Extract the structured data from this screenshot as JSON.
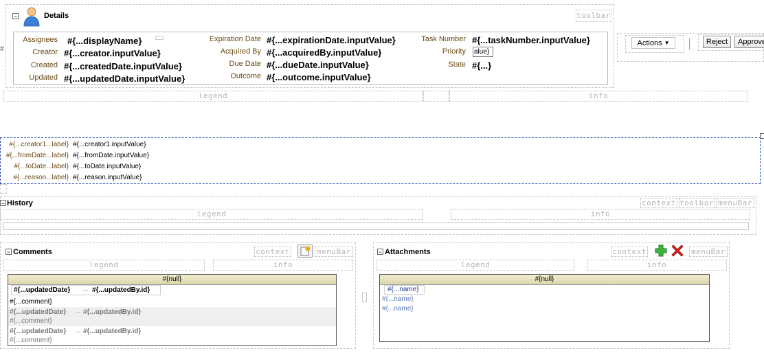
{
  "details": {
    "title": "Details",
    "toolbar_hint": "toolbar",
    "fields": {
      "assignees_label": "Assignees",
      "assignees_value": "#{...displayName}",
      "creator_label": "Creator",
      "creator_value": "#{...creator.inputValue}",
      "created_label": "Created",
      "created_value": "#{...createdDate.inputValue}",
      "updated_label": "Updated",
      "updated_value": "#{...updatedDate.inputValue}",
      "expiration_label": "Expiration Date",
      "expiration_value": "#{...expirationDate.inputValue}",
      "acquired_label": "Acquired By",
      "acquired_value": "#{...acquiredBy.inputValue}",
      "due_label": "Due Date",
      "due_value": "#{...dueDate.inputValue}",
      "outcome_label": "Outcome",
      "outcome_value": "#{...outcome.inputValue}",
      "task_label": "Task Number",
      "task_value": "#{...taskNumber.inputValue}",
      "priority_label": "Priority",
      "priority_value": "alue}",
      "state_label": "State",
      "state_value": "#{...}"
    },
    "legend_hint": "legend",
    "info_hint": "info"
  },
  "actions": {
    "actions_label": "Actions",
    "reject_label": "Reject",
    "approve_label": "Approve"
  },
  "form": {
    "rows": [
      {
        "label": "#{...creator1...label}",
        "value": "#{...creator1.inputValue}"
      },
      {
        "label": "#{...fromDate...label}",
        "value": "#{...fromDate.inputValue}"
      },
      {
        "label": "#{...toDate...label}",
        "value": "#{...toDate.inputValue}"
      },
      {
        "label": "#{...reason...label}",
        "value": "#{...reason.inputValue}"
      }
    ]
  },
  "history": {
    "title": "History",
    "context_hint": "context",
    "toolbar_hint": "toolbar",
    "menubar_hint": "menuBar",
    "legend_hint": "legend",
    "info_hint": "info"
  },
  "comments": {
    "title": "Comments",
    "context_hint": "context",
    "menubar_hint": "menuBar",
    "legend_hint": "legend",
    "info_hint": "info",
    "table_header": "#{null}",
    "head_date": "#{...updatedDate}",
    "head_by": "#{...updatedBy.id}",
    "row1_comment": "#{...comment}",
    "row2_date": "#{...updatedDate}",
    "row2_by": "#{...updatedBy.id}",
    "row2_comment": "#{...comment}",
    "row3_date": "#{...updatedDate}",
    "row3_by": "#{...updatedBy.id}",
    "row3_comment": "#{...comment}"
  },
  "attachments": {
    "title": "Attachments",
    "context_hint": "context",
    "menubar_hint": "menuBar",
    "legend_hint": "legend",
    "info_hint": "info",
    "table_header": "#{null}",
    "names": [
      "#{...name}",
      "#{...name}",
      "#{...name}"
    ]
  }
}
